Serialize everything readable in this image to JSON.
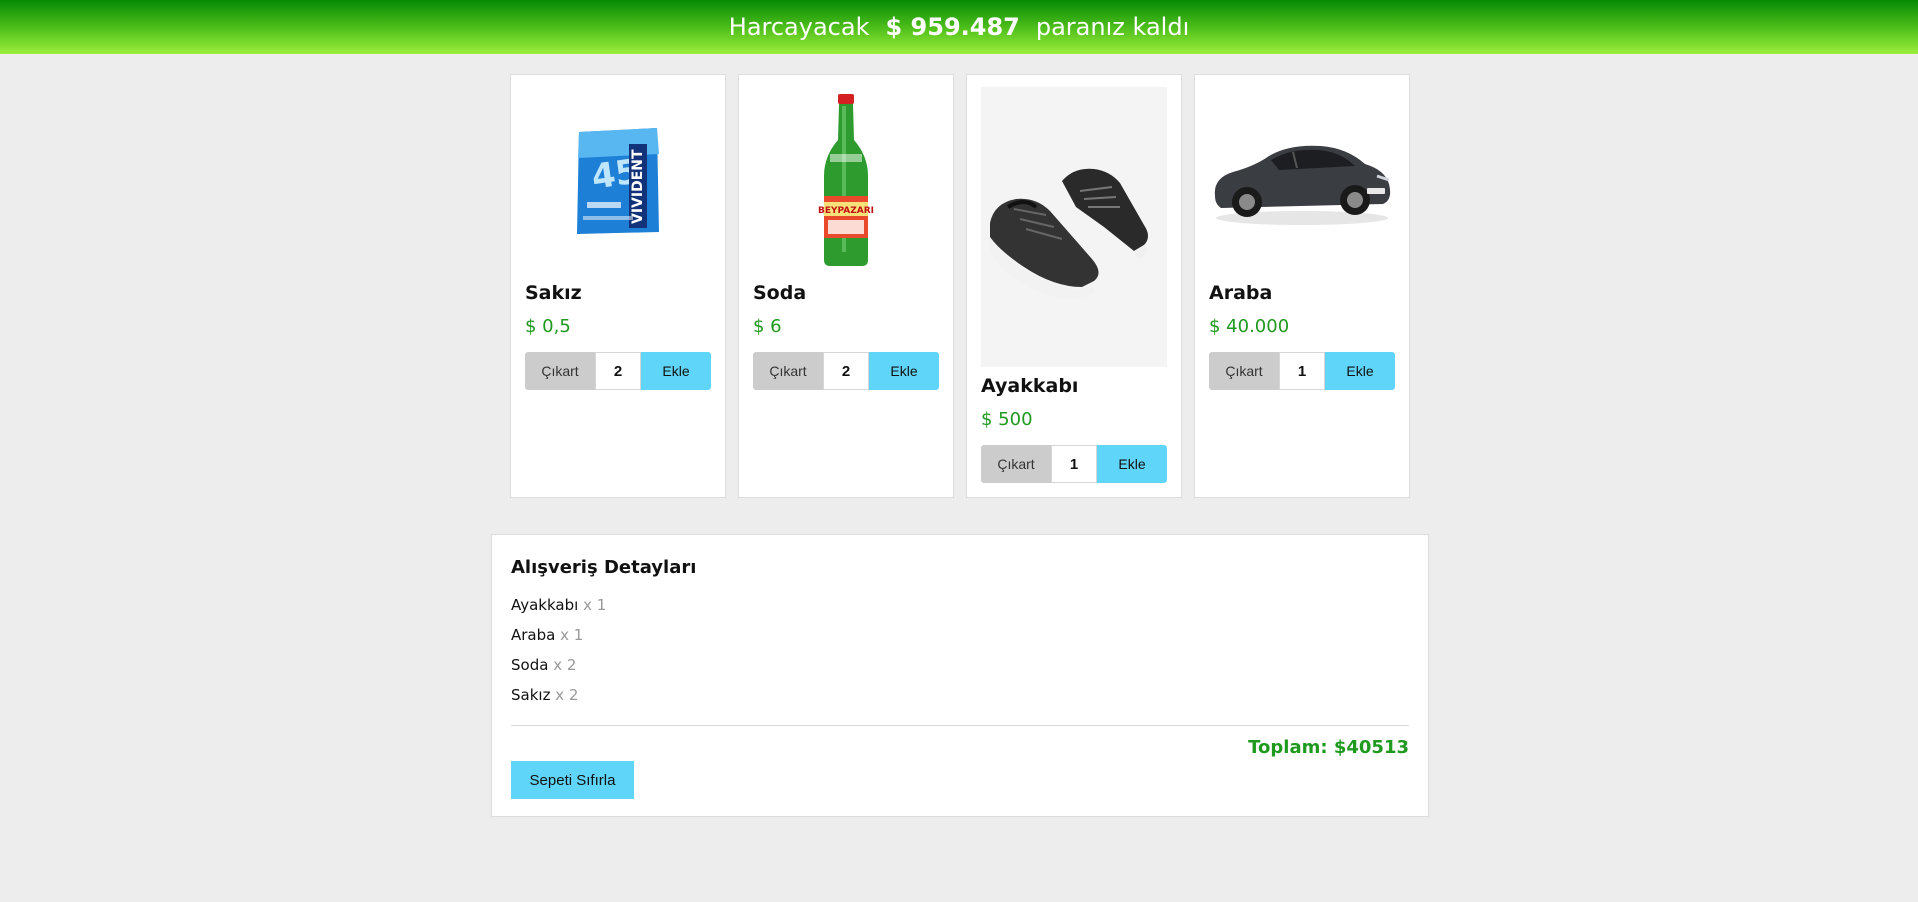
{
  "header": {
    "prefix": "Harcayacak",
    "amount": "$ 959.487",
    "suffix": "paranız kaldı"
  },
  "products": [
    {
      "name": "Sakız",
      "price": "$ 0,5",
      "quantity": "2",
      "remove_label": "Çıkart",
      "add_label": "Ekle"
    },
    {
      "name": "Soda",
      "price": "$ 6",
      "quantity": "2",
      "remove_label": "Çıkart",
      "add_label": "Ekle"
    },
    {
      "name": "Ayakkabı",
      "price": "$ 500",
      "quantity": "1",
      "remove_label": "Çıkart",
      "add_label": "Ekle"
    },
    {
      "name": "Araba",
      "price": "$ 40.000",
      "quantity": "1",
      "remove_label": "Çıkart",
      "add_label": "Ekle"
    }
  ],
  "cart": {
    "title": "Alışveriş Detayları",
    "items": [
      {
        "name": "Ayakkabı",
        "qty": "x 1"
      },
      {
        "name": "Araba",
        "qty": "x 1"
      },
      {
        "name": "Soda",
        "qty": "x 2"
      },
      {
        "name": "Sakız",
        "qty": "x 2"
      }
    ],
    "total": "Toplam: $40513",
    "reset_label": "Sepeti Sıfırla"
  },
  "colors": {
    "header_gradient_top": "#058a05",
    "header_gradient_bottom": "#9bee3a",
    "price_green": "#1f9a1f",
    "add_button": "#5fd5f9",
    "remove_button": "#cccccc"
  }
}
